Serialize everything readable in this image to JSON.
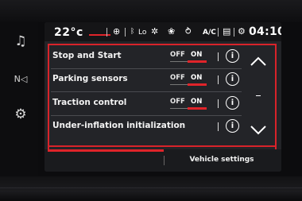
{
  "status_bar": {
    "temperature": "22°c",
    "icons": [
      "navigation-pin-icon",
      "bluetooth-icon",
      "lo-fan-icon",
      "recirculation-icon",
      "seat-heat-icon",
      "airflow-icon",
      "ac-icon",
      "phone-icon",
      "settings-gear-icon"
    ],
    "lo_label": "Lo",
    "ac_label": "A/C",
    "time": "04:10"
  },
  "sidebar": {
    "items": [
      {
        "icon": "music-icon",
        "glyph": "♫"
      },
      {
        "icon": "navigation-icon",
        "glyph": "N◁"
      },
      {
        "icon": "car-settings-icon",
        "glyph": "⚙"
      }
    ]
  },
  "settings": {
    "rows": [
      {
        "label": "Stop and Start",
        "has_toggle": true,
        "off_label": "OFF",
        "on_label": "ON",
        "state": "ON"
      },
      {
        "label": "Parking sensors",
        "has_toggle": true,
        "off_label": "OFF",
        "on_label": "ON",
        "state": "ON"
      },
      {
        "label": "Traction control",
        "has_toggle": true,
        "off_label": "OFF",
        "on_label": "ON",
        "state": "ON"
      },
      {
        "label": "Under-inflation initialization",
        "has_toggle": false
      }
    ],
    "info_glyph": "i"
  },
  "scroll": {
    "up_glyph": "︿",
    "down_glyph": "﹀"
  },
  "tabs": [
    {
      "label": "",
      "active": true
    },
    {
      "label": "Vehicle settings",
      "active": false
    }
  ],
  "colors": {
    "accent": "#e0242a",
    "panel": "#232428",
    "background": "#0c0c0e"
  }
}
